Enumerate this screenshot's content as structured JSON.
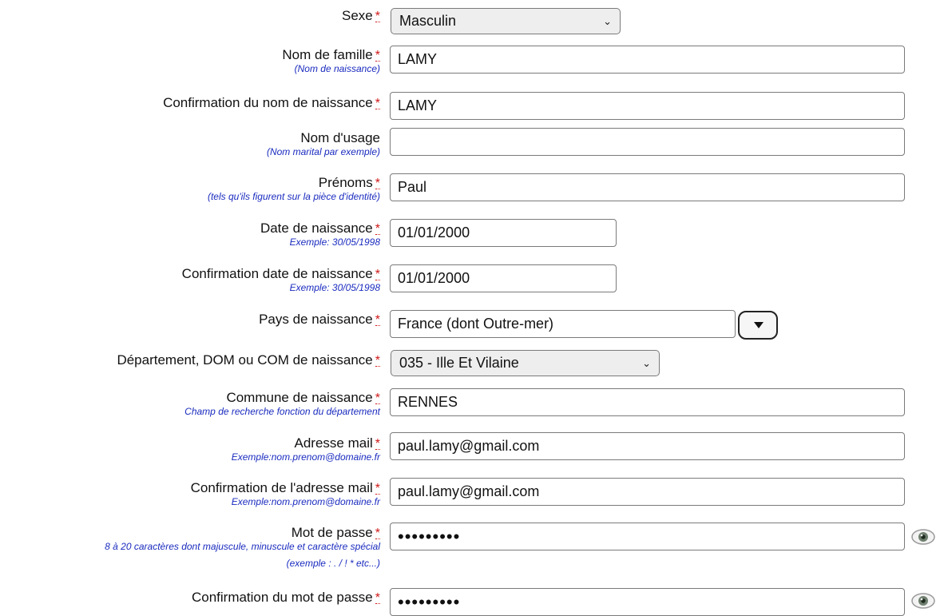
{
  "required_marker": "*",
  "colors": {
    "required": "#d01818",
    "hint": "#1a2bbf",
    "border": "#7a7a7a",
    "select_bg": "#eeeeee"
  },
  "fields": {
    "sexe": {
      "label": "Sexe",
      "value": "Masculin"
    },
    "nom_famille": {
      "label": "Nom de famille",
      "hint": "(Nom de naissance)",
      "value": "LAMY"
    },
    "conf_nom": {
      "label": "Confirmation du nom de naissance",
      "value": "LAMY"
    },
    "nom_usage": {
      "label": "Nom d'usage",
      "hint": "(Nom marital par exemple)",
      "value": ""
    },
    "prenoms": {
      "label": "Prénoms",
      "hint": "(tels qu'ils figurent sur la pièce d'identité)",
      "value": "Paul"
    },
    "date_naissance": {
      "label": "Date de naissance",
      "hint": "Exemple: 30/05/1998",
      "value": "01/01/2000"
    },
    "conf_date": {
      "label": "Confirmation date de naissance",
      "hint": "Exemple: 30/05/1998",
      "value": "01/01/2000"
    },
    "pays": {
      "label": "Pays de naissance",
      "value": "France (dont Outre-mer)"
    },
    "departement": {
      "label": "Département, DOM ou COM de naissance",
      "value": "035 - Ille Et Vilaine"
    },
    "commune": {
      "label": "Commune de naissance",
      "hint": "Champ de recherche fonction du département",
      "value": "RENNES"
    },
    "email": {
      "label": "Adresse mail",
      "hint": "Exemple:nom.prenom@domaine.fr",
      "value": "paul.lamy@gmail.com"
    },
    "conf_email": {
      "label": "Confirmation de l'adresse mail",
      "hint": "Exemple:nom.prenom@domaine.fr",
      "value": "paul.lamy@gmail.com"
    },
    "password": {
      "label": "Mot de passe",
      "hint": "8 à 20 caractères dont majuscule, minuscule et caractère spécial",
      "hint2": "(exemple : . / ! * etc...)",
      "value": "•••••••••"
    },
    "conf_password": {
      "label": "Confirmation du mot de passe",
      "value": "•••••••••"
    }
  },
  "icons": {
    "dropdown": "chevron-down-icon",
    "toggle_password": "eye-icon"
  }
}
